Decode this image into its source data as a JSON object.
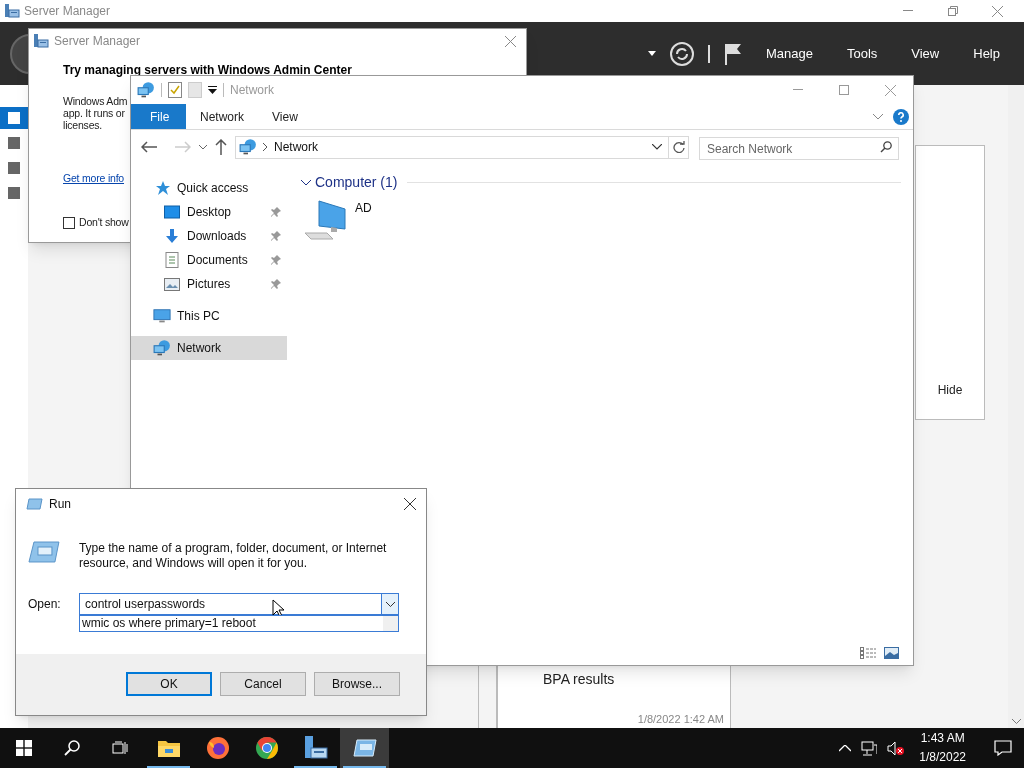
{
  "server_manager": {
    "title": "Server Manager",
    "menu": [
      "Manage",
      "Tools",
      "View",
      "Help"
    ],
    "sidebar_items": [
      {
        "selected": true
      },
      {
        "selected": false
      },
      {
        "selected": false
      },
      {
        "selected": false
      }
    ],
    "hide_button": "Hide",
    "bpa_tile": {
      "title": "BPA results",
      "timestamp": "1/8/2022 1:42 AM"
    }
  },
  "wac_dialog": {
    "title": "Server Manager",
    "heading": "Try managing servers with Windows Admin Center",
    "body_lines": [
      "Windows Adm",
      "app. It runs or",
      "licenses."
    ],
    "link": "Get more info",
    "checkbox": {
      "label": "Don't show",
      "checked": false
    }
  },
  "explorer": {
    "title": "Network",
    "ribbon_tabs": [
      {
        "label": "File",
        "selected": true
      },
      {
        "label": "Network",
        "selected": false
      },
      {
        "label": "View",
        "selected": false
      }
    ],
    "address": "Network",
    "search": {
      "placeholder": "Search Network"
    },
    "nav": [
      {
        "label": "Quick access",
        "kind": "star",
        "selected": false,
        "children": [
          {
            "label": "Desktop",
            "kind": "desktop",
            "pinned": true
          },
          {
            "label": "Downloads",
            "kind": "download",
            "pinned": true
          },
          {
            "label": "Documents",
            "kind": "document",
            "pinned": true
          },
          {
            "label": "Pictures",
            "kind": "picture",
            "pinned": true
          }
        ]
      },
      {
        "label": "This PC",
        "kind": "pc",
        "selected": false
      },
      {
        "label": "Network",
        "kind": "network",
        "selected": true
      }
    ],
    "group": {
      "header": "Computer (1)",
      "items": [
        {
          "label": "AD"
        }
      ]
    }
  },
  "run_dialog": {
    "title": "Run",
    "description": "Type the name of a program, folder, document, or Internet resource, and Windows will open it for you.",
    "open_label": "Open:",
    "value": "control userpasswords",
    "suggestions": [
      "wmic os where primary=1 reboot"
    ],
    "buttons": [
      {
        "label": "OK",
        "default": true
      },
      {
        "label": "Cancel",
        "default": false
      },
      {
        "label": "Browse...",
        "default": false
      }
    ]
  },
  "taskbar": {
    "apps": [
      {
        "kind": "explorer",
        "running": true,
        "selected": false
      },
      {
        "kind": "firefox",
        "running": false,
        "selected": false
      },
      {
        "kind": "chrome",
        "running": false,
        "selected": false
      },
      {
        "kind": "server-manager",
        "running": true,
        "selected": false
      },
      {
        "kind": "run",
        "running": true,
        "selected": true
      }
    ],
    "clock": {
      "time": "1:43 AM",
      "date": "1/8/2022"
    }
  }
}
